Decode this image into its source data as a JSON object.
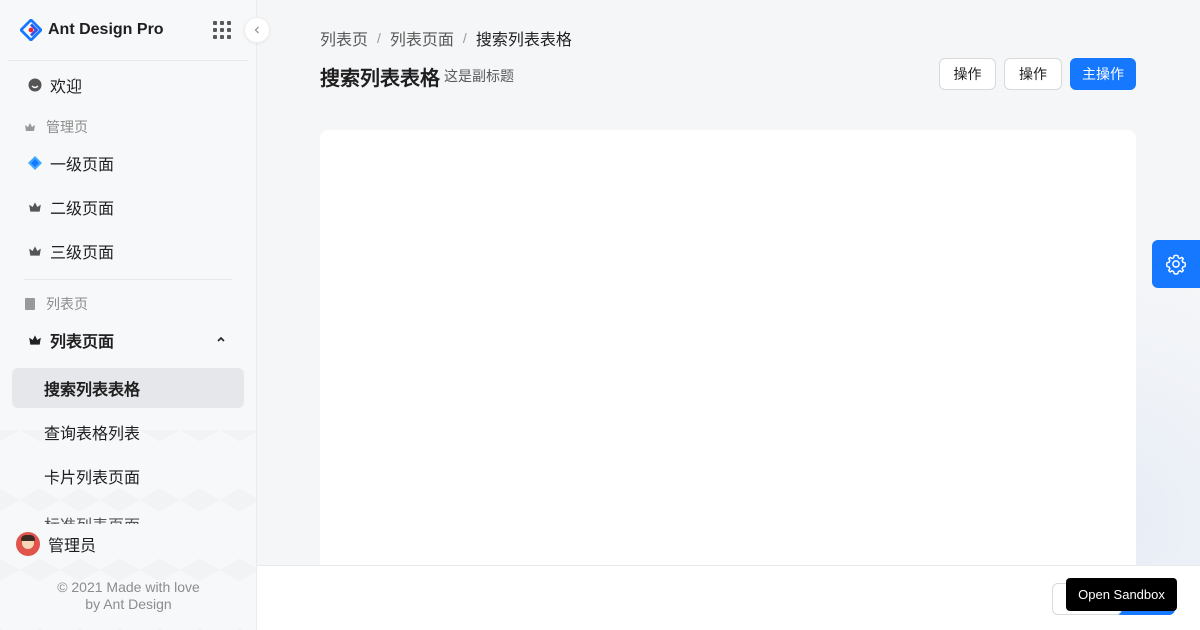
{
  "app": {
    "title": "Ant Design Pro",
    "logo_icon": "ant-design-logo-icon",
    "brand_color": "#1677ff"
  },
  "sidebar": {
    "apps_icon": "apps-grid-icon",
    "collapse_icon": "chevron-left-icon",
    "items": [
      {
        "label": "欢迎",
        "icon": "smile-icon",
        "type": "item"
      },
      {
        "label": "管理页",
        "icon": "crown-icon",
        "type": "group"
      },
      {
        "label": "一级页面",
        "icon": "diamond-icon",
        "type": "item"
      },
      {
        "label": "二级页面",
        "icon": "crown-icon",
        "type": "item"
      },
      {
        "label": "三级页面",
        "icon": "crown-icon",
        "type": "item"
      },
      {
        "label": "列表页",
        "icon": "table-icon",
        "type": "group"
      },
      {
        "label": "列表页面",
        "icon": "crown-icon",
        "type": "submenu",
        "expanded": true
      }
    ],
    "subitems": [
      {
        "label": "搜索列表表格",
        "active": true
      },
      {
        "label": "查询表格列表",
        "active": false
      },
      {
        "label": "卡片列表页面",
        "active": false
      },
      {
        "label": "标准列表页面",
        "active": false
      }
    ],
    "user": {
      "name": "管理员"
    },
    "footer": {
      "line1": "© 2021 Made with love",
      "line2": "by Ant Design"
    }
  },
  "header": {
    "breadcrumb": [
      "列表页",
      "列表页面",
      "搜索列表表格"
    ],
    "title": "搜索列表表格",
    "subtitle": "这是副标题",
    "actions": [
      {
        "label": "操作",
        "primary": false
      },
      {
        "label": "操作",
        "primary": false
      },
      {
        "label": "主操作",
        "primary": true
      }
    ]
  },
  "settings_icon": "gear-icon",
  "tooltip": {
    "label": "Open Sandbox"
  }
}
